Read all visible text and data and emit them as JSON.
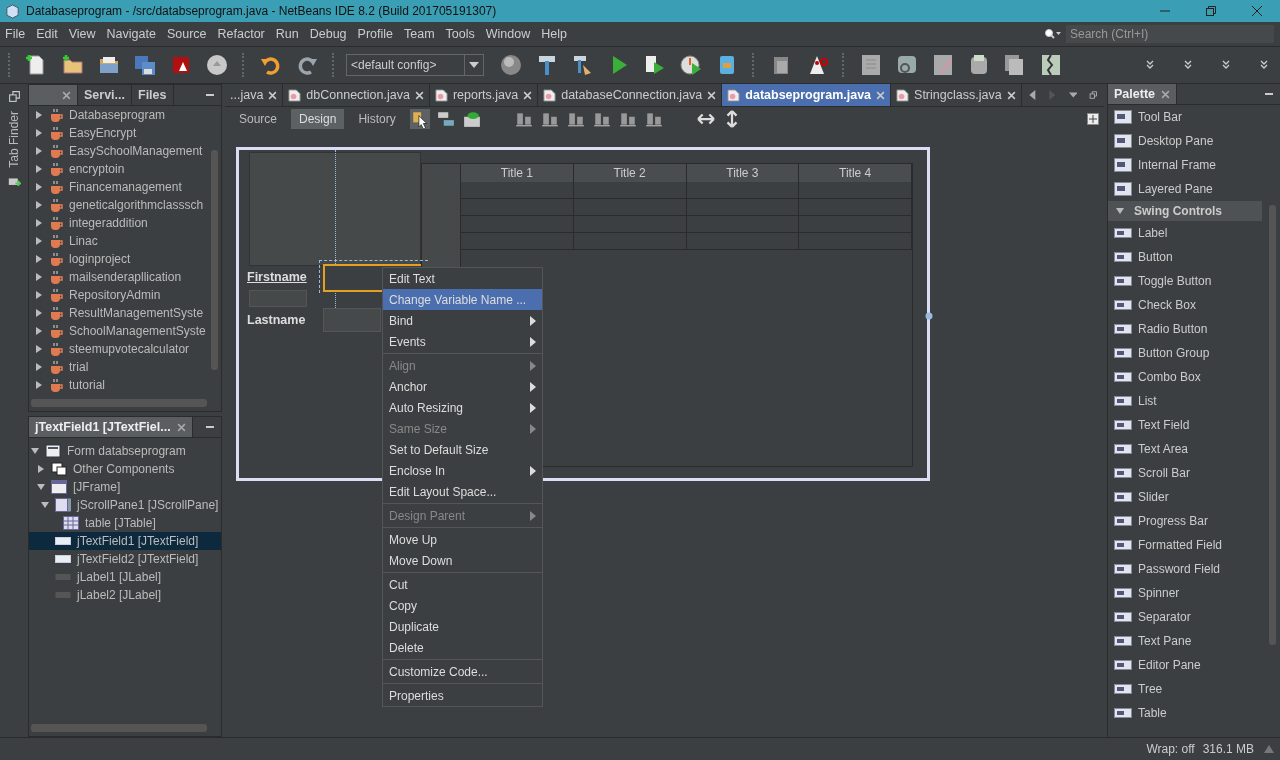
{
  "window": {
    "title": "Databaseprogram - /src/databseprogram.java - NetBeans IDE 8.2 (Build 201705191307)"
  },
  "menu_bar": [
    "File",
    "Edit",
    "View",
    "Navigate",
    "Source",
    "Refactor",
    "Run",
    "Debug",
    "Profile",
    "Team",
    "Tools",
    "Window",
    "Help"
  ],
  "search": {
    "placeholder": "Search (Ctrl+I)"
  },
  "toolbar": {
    "config": "<default config>"
  },
  "side_strip": {
    "label": "Tab Finder"
  },
  "projects_panel": {
    "tabs": [
      {
        "label": "Servi...",
        "selected": false
      },
      {
        "label": "Files",
        "selected": false
      }
    ],
    "items": [
      {
        "label": "Databaseprogram",
        "expanded": false
      },
      {
        "label": "EasyEncrypt",
        "expanded": false
      },
      {
        "label": "EasySchoolManagement",
        "expanded": false
      },
      {
        "label": "encryptoin",
        "expanded": false
      },
      {
        "label": "Financemanagement",
        "expanded": false
      },
      {
        "label": "geneticalgorithmclasssch",
        "expanded": false
      },
      {
        "label": "integeraddition",
        "expanded": false
      },
      {
        "label": "Linac",
        "expanded": false
      },
      {
        "label": "loginproject",
        "expanded": false
      },
      {
        "label": "mailsenderapllication",
        "expanded": false
      },
      {
        "label": "RepositoryAdmin",
        "expanded": false
      },
      {
        "label": "ResultManagementSyste",
        "expanded": false
      },
      {
        "label": "SchoolManagementSyste",
        "expanded": false
      },
      {
        "label": "steemupvotecalculator",
        "expanded": false
      },
      {
        "label": "trial",
        "expanded": false
      },
      {
        "label": "tutorial",
        "expanded": false
      }
    ]
  },
  "navigator": {
    "title": "jTextField1 [JTextFiel...",
    "tree": [
      {
        "label": "Form databseprogram",
        "kind": "form",
        "expanded": true,
        "selected": false,
        "children": [
          {
            "label": "Other Components",
            "kind": "other",
            "expanded": false,
            "selected": false
          },
          {
            "label": "[JFrame]",
            "kind": "frame",
            "expanded": true,
            "selected": false,
            "children": [
              {
                "label": "jScrollPane1 [JScrollPane]",
                "kind": "scrollpane",
                "expanded": true,
                "selected": false,
                "children": [
                  {
                    "label": "table [JTable]",
                    "kind": "table",
                    "selected": false
                  }
                ]
              },
              {
                "label": "jTextField1 [JTextField]",
                "kind": "textfield",
                "selected": true
              },
              {
                "label": "jTextField2 [JTextField]",
                "kind": "textfield",
                "selected": false
              },
              {
                "label": "jLabel1 [JLabel]",
                "kind": "label",
                "selected": false
              },
              {
                "label": "jLabel2 [JLabel]",
                "kind": "label",
                "selected": false
              }
            ]
          }
        ]
      }
    ]
  },
  "editor_tabs": [
    {
      "label": "...java",
      "selected": false
    },
    {
      "label": "dbConnection.java",
      "selected": false
    },
    {
      "label": "reports.java",
      "selected": false
    },
    {
      "label": "databaseConnection.java",
      "selected": false
    },
    {
      "label": "databseprogram.java",
      "selected": true
    },
    {
      "label": "Stringclass.java",
      "selected": false
    }
  ],
  "view_tabs": [
    {
      "label": "Source",
      "selected": false
    },
    {
      "label": "Design",
      "selected": true
    },
    {
      "label": "History",
      "selected": false
    }
  ],
  "form": {
    "labels": [
      "Firstname",
      "Lastname"
    ],
    "table": {
      "columns": [
        "Title 1",
        "Title 2",
        "Title 3",
        "Title 4"
      ]
    }
  },
  "context_menu": {
    "groups": [
      [
        {
          "label": "Edit Text",
          "disabled": false,
          "submenu": false,
          "selected": false
        },
        {
          "label": "Change Variable Name ...",
          "disabled": false,
          "submenu": false,
          "selected": true
        },
        {
          "label": "Bind",
          "disabled": false,
          "submenu": true,
          "selected": false
        },
        {
          "label": "Events",
          "disabled": false,
          "submenu": true,
          "selected": false
        }
      ],
      [
        {
          "label": "Align",
          "disabled": true,
          "submenu": true,
          "selected": false
        },
        {
          "label": "Anchor",
          "disabled": false,
          "submenu": true,
          "selected": false
        },
        {
          "label": "Auto Resizing",
          "disabled": false,
          "submenu": true,
          "selected": false
        },
        {
          "label": "Same Size",
          "disabled": true,
          "submenu": true,
          "selected": false
        },
        {
          "label": "Set to Default Size",
          "disabled": false,
          "submenu": false,
          "selected": false
        },
        {
          "label": "Enclose In",
          "disabled": false,
          "submenu": true,
          "selected": false
        },
        {
          "label": "Edit Layout Space...",
          "disabled": false,
          "submenu": false,
          "selected": false
        }
      ],
      [
        {
          "label": "Design Parent",
          "disabled": true,
          "submenu": true,
          "selected": false
        }
      ],
      [
        {
          "label": "Move Up",
          "disabled": false,
          "submenu": false,
          "selected": false
        },
        {
          "label": "Move Down",
          "disabled": false,
          "submenu": false,
          "selected": false
        }
      ],
      [
        {
          "label": "Cut",
          "disabled": false,
          "submenu": false,
          "selected": false
        },
        {
          "label": "Copy",
          "disabled": false,
          "submenu": false,
          "selected": false
        },
        {
          "label": "Duplicate",
          "disabled": false,
          "submenu": false,
          "selected": false
        },
        {
          "label": "Delete",
          "disabled": false,
          "submenu": false,
          "selected": false
        }
      ],
      [
        {
          "label": "Customize Code...",
          "disabled": false,
          "submenu": false,
          "selected": false
        }
      ],
      [
        {
          "label": "Properties",
          "disabled": false,
          "submenu": false,
          "selected": false
        }
      ]
    ]
  },
  "palette": {
    "title": "Palette",
    "items_above": [
      "Tool Bar",
      "Desktop Pane",
      "Internal Frame",
      "Layered Pane"
    ],
    "sections": [
      {
        "label": "Swing Controls",
        "expanded": true,
        "items": [
          "Label",
          "Button",
          "Toggle Button",
          "Check Box",
          "Radio Button",
          "Button Group",
          "Combo Box",
          "List",
          "Text Field",
          "Text Area",
          "Scroll Bar",
          "Slider",
          "Progress Bar",
          "Formatted Field",
          "Password Field",
          "Spinner",
          "Separator",
          "Text Pane",
          "Editor Pane",
          "Tree",
          "Table"
        ]
      }
    ]
  },
  "status_bar": {
    "wrap": "Wrap: off",
    "memory": "316.1 MB"
  }
}
